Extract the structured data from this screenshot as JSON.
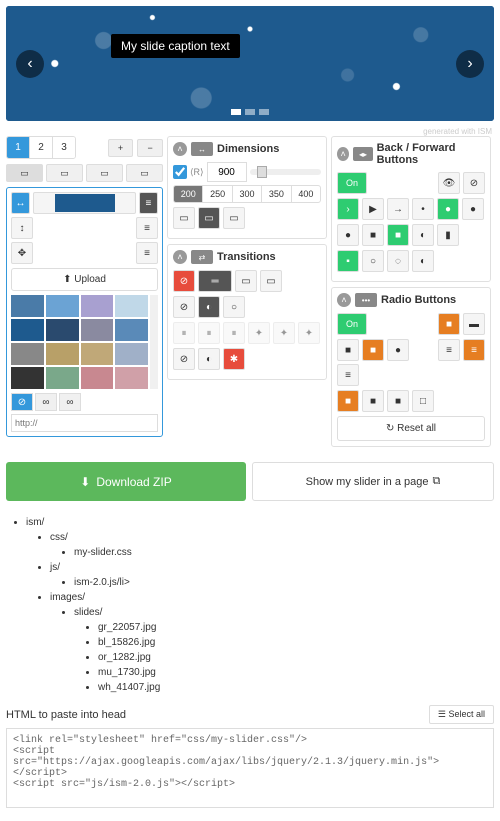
{
  "hero": {
    "caption": "My slide caption text",
    "generated": "generated with ISM"
  },
  "tabs": {
    "t1": "1",
    "t2": "2",
    "t3": "3"
  },
  "upload": "Upload",
  "link_placeholder": "http://",
  "dimensions": {
    "title": "Dimensions",
    "width": "900",
    "presets": [
      "200",
      "250",
      "300",
      "350",
      "400"
    ]
  },
  "transitions": {
    "title": "Transitions"
  },
  "backforward": {
    "title": "Back / Forward Buttons",
    "on": "On"
  },
  "radio": {
    "title": "Radio Buttons",
    "on": "On",
    "reset": "Reset all"
  },
  "download": "Download ZIP",
  "showpage": "Show my slider in a page",
  "tree": {
    "root": "ism/",
    "css": "css/",
    "cssfile": "my-slider.css",
    "js": "js/",
    "jsfile": "ism-2.0.js/li>",
    "images": "images/",
    "slides": "slides/",
    "f1": "gr_22057.jpg",
    "f2": "bl_15826.jpg",
    "f3": "or_1282.jpg",
    "f4": "mu_1730.jpg",
    "f5": "wh_41407.jpg"
  },
  "paste_label": "HTML to paste into head",
  "select_all": "Select all",
  "code": "<link rel=\"stylesheet\" href=\"css/my-slider.css\"/>\n<script src=\"https://ajax.googleapis.com/ajax/libs/jquery/2.1.3/jquery.min.js\"></script>\n<script src=\"js/ism-2.0.js\"></script>"
}
